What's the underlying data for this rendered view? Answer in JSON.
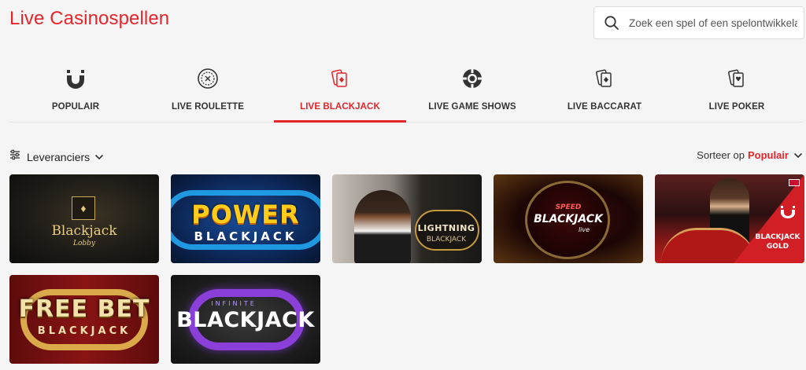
{
  "page_title": "Live Casinospellen",
  "search": {
    "placeholder": "Zoek een spel of een spelontwikkelaar",
    "icon": "search-icon"
  },
  "tabs": [
    {
      "label": "POPULAIR",
      "icon": "popular-brand-icon",
      "active": false
    },
    {
      "label": "LIVE ROULETTE",
      "icon": "roulette-wheel-icon",
      "active": false
    },
    {
      "label": "LIVE BLACKJACK",
      "icon": "blackjack-cards-icon",
      "active": true
    },
    {
      "label": "LIVE GAME SHOWS",
      "icon": "poker-chip-icon",
      "active": false
    },
    {
      "label": "LIVE BACCARAT",
      "icon": "baccarat-cards-icon",
      "active": false
    },
    {
      "label": "LIVE POKER",
      "icon": "poker-cards-icon",
      "active": false
    }
  ],
  "filter": {
    "label": "Leveranciers",
    "icon": "sliders-icon"
  },
  "sort": {
    "prefix": "Sorteer op",
    "value": "Populair"
  },
  "games": [
    {
      "title": "Blackjack",
      "subtitle": "Lobby"
    },
    {
      "title": "POWER",
      "subtitle": "BLACKJACK"
    },
    {
      "title": "LIGHTNING",
      "subtitle": "BLACKJACK"
    },
    {
      "title": "SPEED",
      "subtitle": "BLACKJACK",
      "tag": "live"
    },
    {
      "title": "BLACKJACK",
      "subtitle": "GOLD"
    },
    {
      "title": "FREE BET",
      "subtitle": "BLACKJACK"
    },
    {
      "title": "INFINITE",
      "subtitle": "BLACKJACK"
    }
  ],
  "colors": {
    "accent": "#e4262c",
    "background": "#f5f5f5"
  }
}
